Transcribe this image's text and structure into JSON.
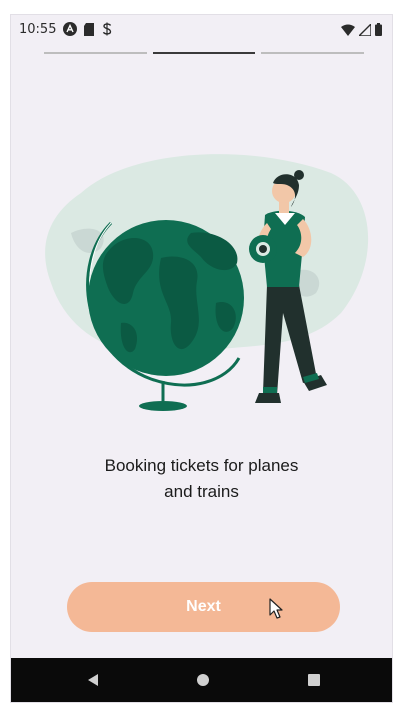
{
  "status_bar": {
    "time": "10:55",
    "left_icons": [
      "app-a-icon",
      "sd-card-icon",
      "sync-s-icon"
    ],
    "right_icons": [
      "wifi-icon",
      "signal-icon",
      "battery-icon"
    ]
  },
  "progress": {
    "total_steps": 3,
    "current_step": 2
  },
  "illustration": {
    "name": "woman-with-globe-illustration",
    "colors": {
      "primary_green": "#0f6e52",
      "dark_green": "#0b5a43",
      "blob": "#dbe9e3",
      "pants": "#21302d"
    }
  },
  "onboarding": {
    "title_line1": "Booking tickets for planes",
    "title_line2": "and trains"
  },
  "next_button": {
    "label": "Next",
    "color": "#f4b896"
  },
  "nav_bar": {
    "back": "back-triangle-icon",
    "home": "home-circle-icon",
    "recents": "recents-square-icon"
  }
}
